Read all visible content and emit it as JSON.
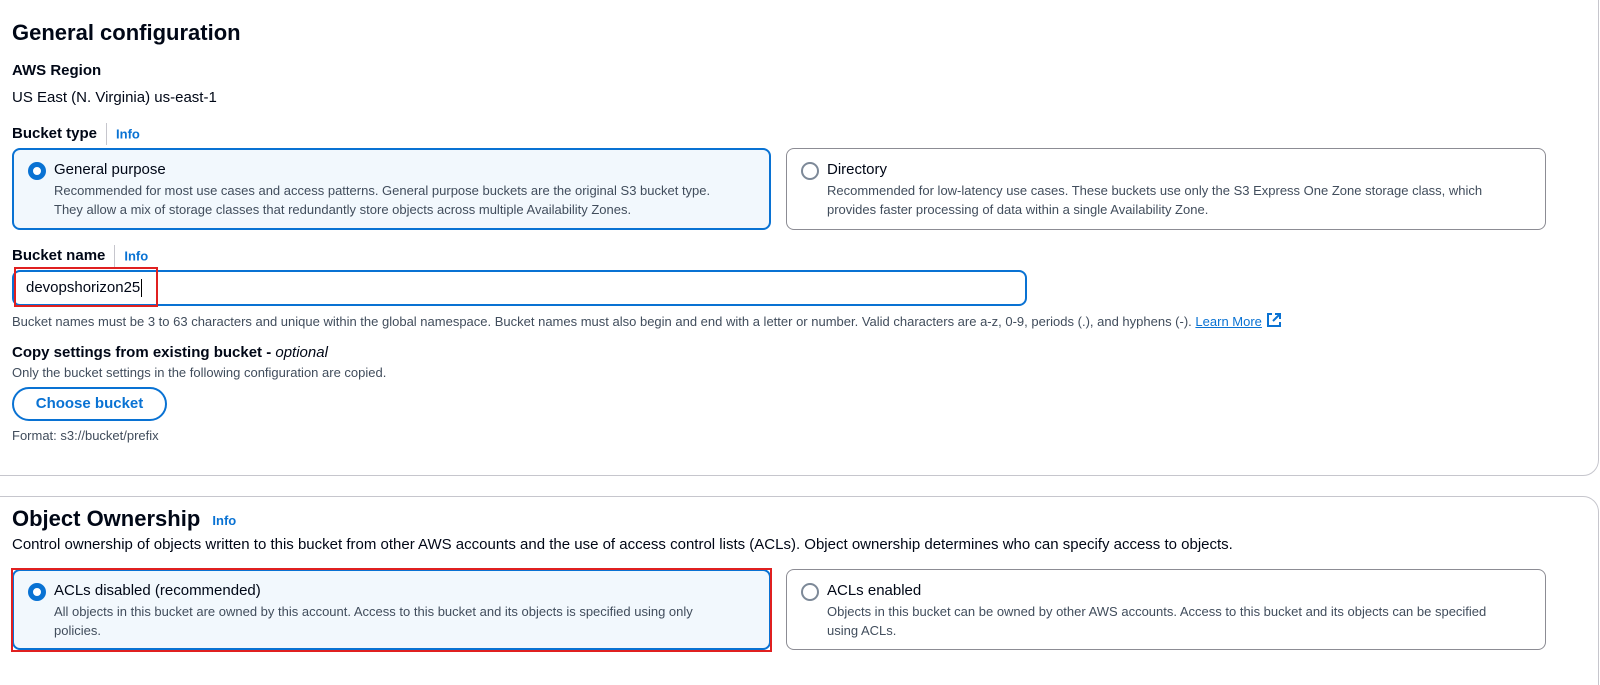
{
  "general": {
    "title": "General configuration",
    "region_label": "AWS Region",
    "region_value": "US East (N. Virginia) us-east-1",
    "bucket_type_label": "Bucket type",
    "bucket_type_info": "Info",
    "options": [
      {
        "title": "General purpose",
        "desc1": "Recommended for most use cases and access patterns. General purpose buckets are the original S3 bucket type.",
        "desc2": "They allow a mix of storage classes that redundantly store objects across multiple Availability Zones.",
        "selected": true
      },
      {
        "title": "Directory",
        "desc1": "Recommended for low-latency use cases. These buckets use only the S3 Express One Zone storage class, which",
        "desc2": "provides faster processing of data within a single Availability Zone.",
        "selected": false
      }
    ],
    "bucket_name_label": "Bucket name",
    "bucket_name_info": "Info",
    "bucket_name_value": "devopshorizon25",
    "bucket_name_help": "Bucket names must be 3 to 63 characters and unique within the global namespace. Bucket names must also begin and end with a letter or number. Valid characters are a-z, 0-9, periods (.), and hyphens (-).",
    "learn_more": "Learn More",
    "copy_label": "Copy settings from existing bucket - ",
    "copy_optional": "optional",
    "copy_desc": "Only the bucket settings in the following configuration are copied.",
    "choose_bucket": "Choose bucket",
    "format_hint": "Format: s3://bucket/prefix"
  },
  "ownership": {
    "title": "Object Ownership",
    "info": "Info",
    "desc": "Control ownership of objects written to this bucket from other AWS accounts and the use of access control lists (ACLs). Object ownership determines who can specify access to objects.",
    "options": [
      {
        "title": "ACLs disabled (recommended)",
        "desc1": "All objects in this bucket are owned by this account. Access to this bucket and its objects is specified using only",
        "desc2": "policies.",
        "selected": true
      },
      {
        "title": "ACLs enabled",
        "desc1": "Objects in this bucket can be owned by other AWS accounts. Access to this bucket and its objects can be specified",
        "desc2": "using ACLs.",
        "selected": false
      }
    ]
  },
  "colors": {
    "accent": "#0972d3",
    "highlight": "#e02020",
    "selected_bg": "#f2f8fd"
  },
  "icons": [
    "external-link-icon",
    "radio-selected-icon",
    "radio-unselected-icon"
  ]
}
